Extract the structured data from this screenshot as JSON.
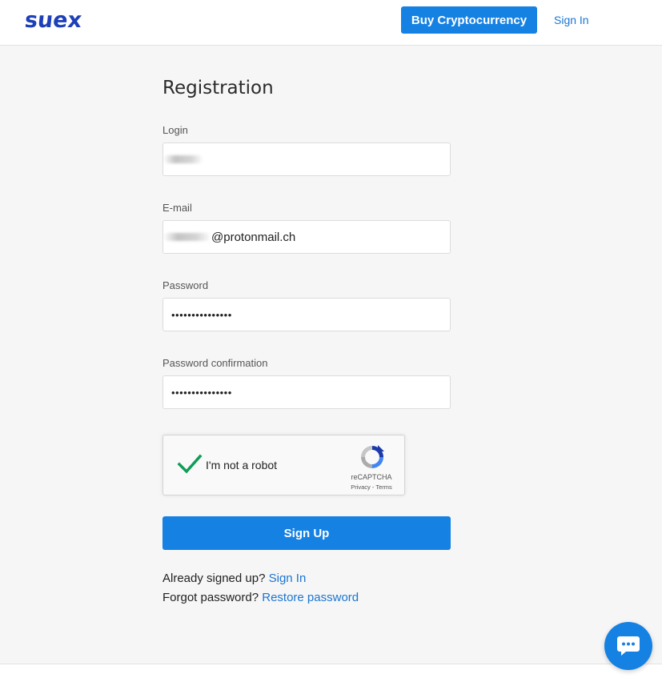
{
  "header": {
    "logo_text": "suex",
    "buy_label": "Buy Cryptocurrency",
    "signin_label": "Sign In"
  },
  "form": {
    "title": "Registration",
    "login": {
      "label": "Login",
      "value": ""
    },
    "email": {
      "label": "E-mail",
      "value": "@protonmail.ch"
    },
    "password": {
      "label": "Password",
      "value": "•••••••••••••••"
    },
    "password_confirmation": {
      "label": "Password confirmation",
      "value": "•••••••••••••••"
    },
    "captcha": {
      "label": "I'm not a robot",
      "brand": "reCAPTCHA",
      "links": "Privacy - Terms",
      "checked": true
    },
    "submit_label": "Sign Up"
  },
  "footer": {
    "signed_up_text": "Already signed up?",
    "signin_link": "Sign In",
    "forgot_text": "Forgot password?",
    "restore_link": "Restore password"
  },
  "icons": {
    "chat": "chat-bubble-icon",
    "check": "check-icon",
    "recaptcha": "recaptcha-icon"
  },
  "colors": {
    "accent": "#1581e3",
    "link": "#1a76d2",
    "logo": "#1d3fb8",
    "check": "#0f9d58"
  }
}
